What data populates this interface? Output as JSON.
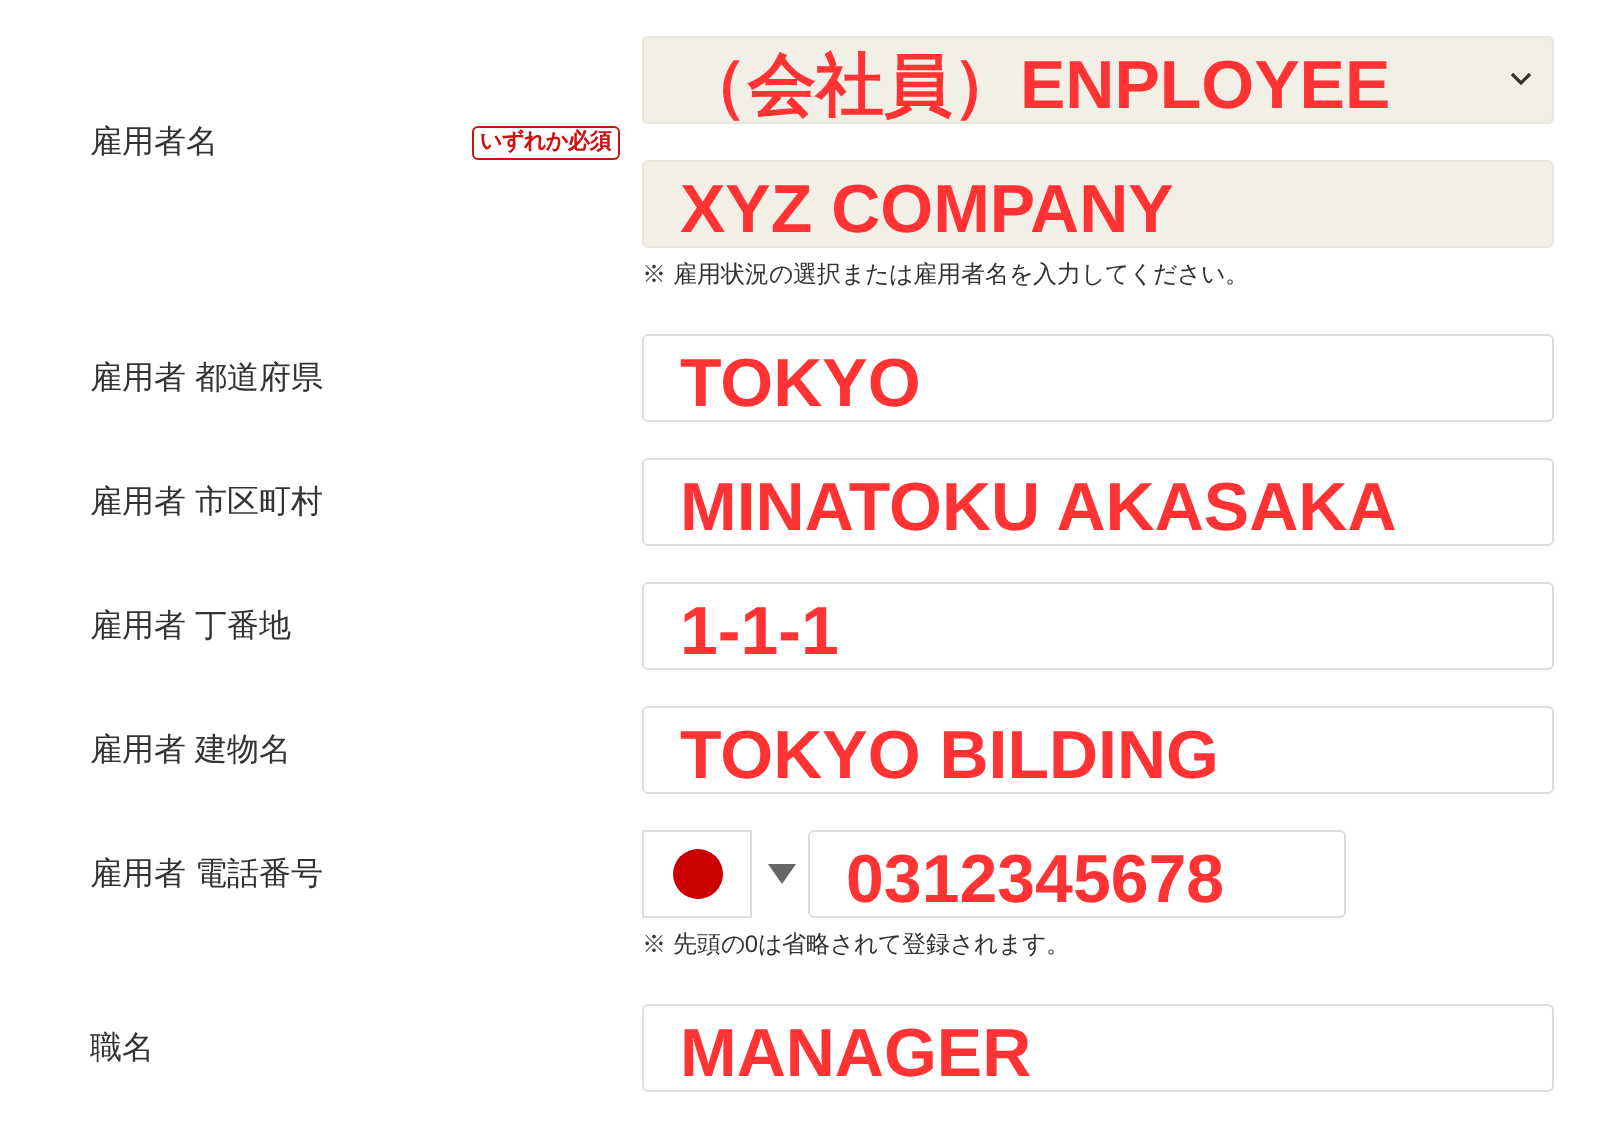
{
  "rows": [
    {
      "kind": "employer",
      "label": "雇用者名",
      "badge": "いずれか必須",
      "select": {
        "value": "（会社員）ENPLOYEE"
      },
      "input": {
        "value": "XYZ COMPANY"
      },
      "hint": "※ 雇用状況の選択または雇用者名を入力してください。"
    },
    {
      "kind": "text",
      "label": "雇用者 都道府県",
      "value": "TOKYO"
    },
    {
      "kind": "text",
      "label": "雇用者 市区町村",
      "value": "MINATOKU AKASAKA"
    },
    {
      "kind": "text",
      "label": "雇用者 丁番地",
      "value": "1-1-1"
    },
    {
      "kind": "text",
      "label": "雇用者 建物名",
      "value": "TOKYO BILDING"
    },
    {
      "kind": "phone",
      "label": "雇用者 電話番号",
      "value": "0312345678",
      "hint": "※ 先頭の0は省略されて登録されます。"
    },
    {
      "kind": "text",
      "label": "職名",
      "value": "MANAGER"
    }
  ]
}
